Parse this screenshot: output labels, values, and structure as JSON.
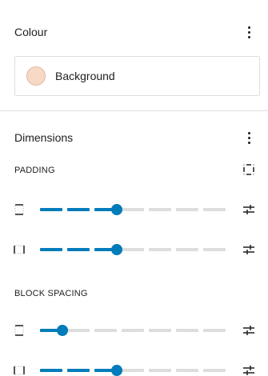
{
  "colour": {
    "title": "Colour",
    "options_icon": "more-vertical-icon",
    "background": {
      "label": "Background",
      "swatch_color": "#f8d9c5"
    }
  },
  "dimensions": {
    "title": "Dimensions",
    "options_icon": "more-vertical-icon",
    "padding": {
      "label": "PADDING",
      "link_icon": "sides-all-icon",
      "controls": [
        {
          "side": "top-bottom",
          "icon": "sides-vertical-icon",
          "level_fraction": 0.43,
          "segments_filled": 3,
          "custom_icon": "settings-sliders-icon"
        },
        {
          "side": "left-right",
          "icon": "sides-horizontal-icon",
          "level_fraction": 0.43,
          "segments_filled": 3,
          "custom_icon": "settings-sliders-icon"
        }
      ]
    },
    "block_spacing": {
      "label": "BLOCK SPACING",
      "controls": [
        {
          "side": "vertical",
          "icon": "sides-vertical-icon",
          "level_fraction": 0.14,
          "segments_filled": 1,
          "custom_icon": "settings-sliders-icon"
        },
        {
          "side": "horizontal",
          "icon": "sides-horizontal-icon",
          "level_fraction": 0.43,
          "segments_filled": 3,
          "custom_icon": "settings-sliders-icon"
        }
      ]
    }
  },
  "accent_color": "#007cba",
  "segments_total": 7
}
